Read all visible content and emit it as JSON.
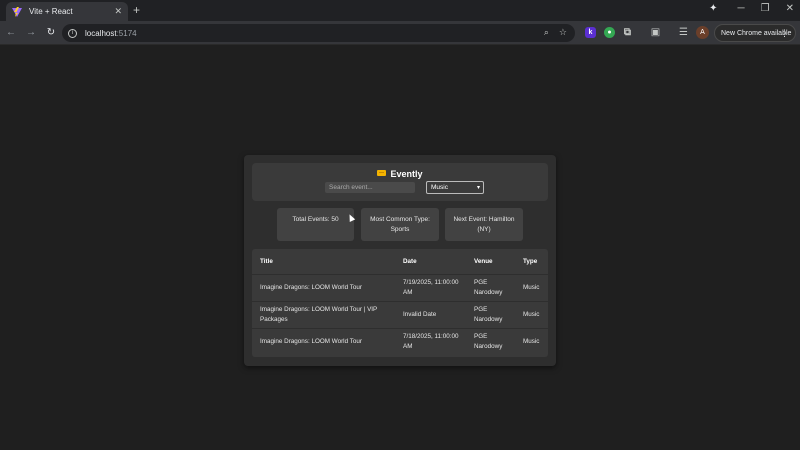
{
  "browser": {
    "tab_title": "Vite + React",
    "tab_close": "✕",
    "new_tab": "+",
    "url_host": "localhost",
    "url_port": ":5174",
    "update_label": "New Chrome available",
    "avatar_letter": "A",
    "ext_k_label": "k"
  },
  "app": {
    "brand": "Evently",
    "search_placeholder": "Search event...",
    "filter_value": "Music",
    "stats": {
      "total_events": "Total Events: 50",
      "most_common_type": "Most Common Type: Sports",
      "next_event": "Next Event: Hamilton (NY)"
    },
    "table": {
      "headers": [
        "Title",
        "Date",
        "Venue",
        "Type"
      ],
      "rows": [
        [
          "Imagine Dragons: LOOM World Tour",
          "7/19/2025, 11:00:00 AM",
          "PGE Narodowy",
          "Music"
        ],
        [
          "Imagine Dragons: LOOM World Tour | VIP Packages",
          "Invalid Date",
          "PGE Narodowy",
          "Music"
        ],
        [
          "Imagine Dragons: LOOM World Tour",
          "7/18/2025, 11:00:00 AM",
          "PGE Narodowy",
          "Music"
        ]
      ]
    }
  },
  "colors": {
    "page_bg": "#1f1f1f",
    "card_bg": "#2e2e2e",
    "panel_bg": "#3a3a3a",
    "stat_bg": "#424242",
    "ticket_accent": "#f4b400"
  }
}
